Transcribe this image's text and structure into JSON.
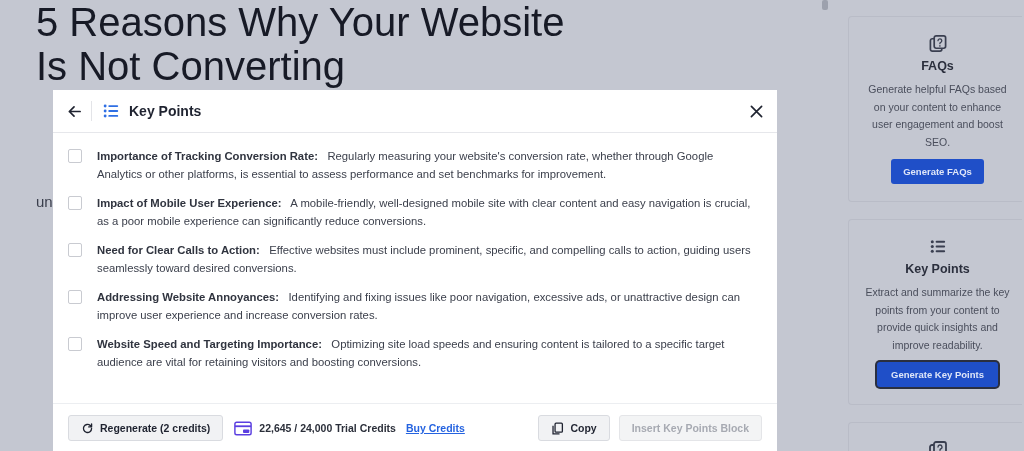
{
  "article": {
    "title": "5 Reasons Why Your Website Is Not Converting",
    "fragment": "un"
  },
  "sidebar": {
    "cards": [
      {
        "kind": "faq",
        "title": "FAQs",
        "description": "Generate helpful FAQs based on your content to enhance user engagement and boost SEO.",
        "button": "Generate FAQs",
        "focused": false
      },
      {
        "kind": "list",
        "title": "Key Points",
        "description": "Extract and summarize the key points from your content to provide quick insights and improve readability.",
        "button": "Generate Key Points",
        "focused": true
      },
      {
        "kind": "faq"
      }
    ]
  },
  "modal": {
    "title": "Key Points",
    "items": [
      {
        "heading": "Importance of Tracking Conversion Rate:",
        "text": "Regularly measuring your website's conversion rate, whether through Google Analytics or other platforms, is essential to assess performance and set benchmarks for improvement.",
        "checked": false
      },
      {
        "heading": "Impact of Mobile User Experience:",
        "text": "A mobile-friendly, well-designed mobile site with clear content and easy navigation is crucial, as a poor mobile experience can significantly reduce conversions.",
        "checked": false
      },
      {
        "heading": "Need for Clear Calls to Action:",
        "text": "Effective websites must include prominent, specific, and compelling calls to action, guiding users seamlessly toward desired conversions.",
        "checked": false
      },
      {
        "heading": "Addressing Website Annoyances:",
        "text": "Identifying and fixing issues like poor navigation, excessive ads, or unattractive design can improve user experience and increase conversion rates.",
        "checked": false
      },
      {
        "heading": "Website Speed and Targeting Importance:",
        "text": "Optimizing site load speeds and ensuring content is tailored to a specific target audience are vital for retaining visitors and boosting conversions.",
        "checked": false
      }
    ],
    "footer": {
      "regenerate": "Regenerate (2 credits)",
      "credits": "22,645 / 24,000 Trial Credits",
      "buy": "Buy Credits",
      "copy": "Copy",
      "insert": {
        "label": "Insert Key Points Block",
        "disabled": true
      }
    }
  }
}
